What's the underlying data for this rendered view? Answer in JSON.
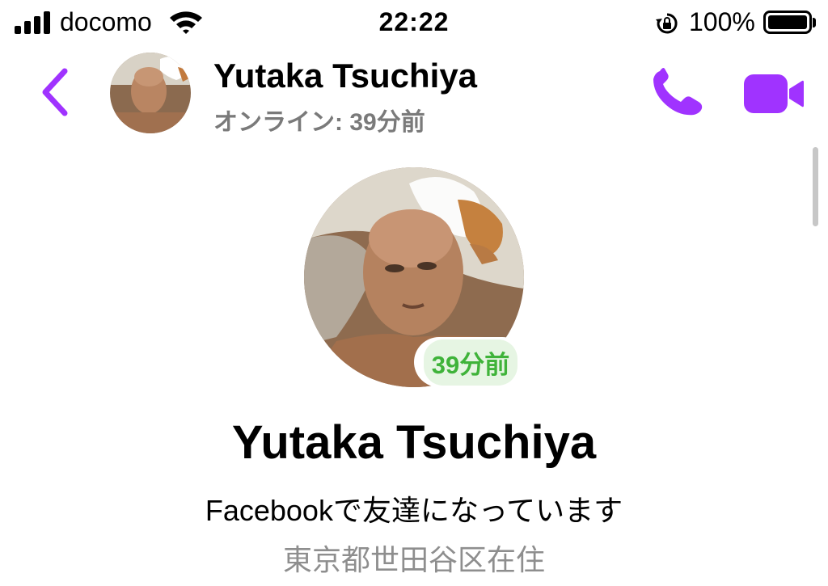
{
  "status_bar": {
    "carrier": "docomo",
    "time": "22:22",
    "battery_percent": "100%",
    "battery_level": 1.0,
    "icons": [
      "signal-icon",
      "wifi-icon",
      "rotation-lock-icon",
      "battery-icon"
    ]
  },
  "header": {
    "name": "Yutaka Tsuchiya",
    "status": "オンライン: 39分前",
    "icons": [
      "back-chevron-icon",
      "phone-icon",
      "video-camera-icon"
    ]
  },
  "profile": {
    "name": "Yutaka Tsuchiya",
    "active_badge": "39分前",
    "friendship": "Facebookで友達になっています",
    "location": "東京都世田谷区在住"
  },
  "colors": {
    "accent": "#A033FF",
    "badge_text": "#3FB33A",
    "badge_bg": "#E6F5E3",
    "secondary_text": "#7A7A7A",
    "tertiary_text": "#8E8E8E"
  }
}
